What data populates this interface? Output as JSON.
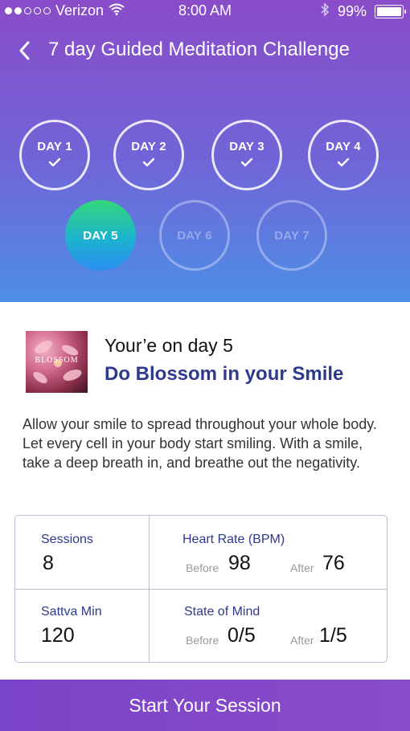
{
  "status_bar": {
    "carrier": "Verizon",
    "time": "8:00 AM",
    "battery": "99%",
    "battery_level": 0.99,
    "signal_bars": 2
  },
  "header": {
    "title": "7 day Guided Meditation Challenge",
    "back_icon": "chevron-left-icon"
  },
  "days": [
    {
      "label": "DAY 1",
      "state": "completed"
    },
    {
      "label": "DAY 2",
      "state": "completed"
    },
    {
      "label": "DAY 3",
      "state": "completed"
    },
    {
      "label": "DAY 4",
      "state": "completed"
    },
    {
      "label": "DAY 5",
      "state": "current"
    },
    {
      "label": "DAY 6",
      "state": "locked"
    },
    {
      "label": "DAY 7",
      "state": "locked"
    }
  ],
  "session": {
    "thumbnail_text": "BLOSSOM",
    "lead": "Your’e on day 5",
    "title": "Do Blossom in your Smile",
    "description": "Allow your smile to spread throughout your whole body. Let every cell in your body start smiling. With a smile, take a deep breath in, and breathe out the negativity."
  },
  "stats": {
    "sessions": {
      "label": "Sessions",
      "value": "8"
    },
    "sattva": {
      "label": "Sattva Min",
      "value": "120"
    },
    "heart_rate": {
      "label": "Heart Rate (BPM)",
      "before_label": "Before",
      "before": "98",
      "after_label": "After",
      "after": "76"
    },
    "state_of_mind": {
      "label": "State of Mind",
      "before_label": "Before",
      "before": "0/5",
      "after_label": "After",
      "after": "1/5"
    }
  },
  "cta": {
    "label": "Start Your Session"
  },
  "colors": {
    "gradient_top": "#8a4cc8",
    "gradient_bottom": "#4d8fe6",
    "accent_text": "#2e3a8c",
    "current_day": "#35d87a"
  }
}
